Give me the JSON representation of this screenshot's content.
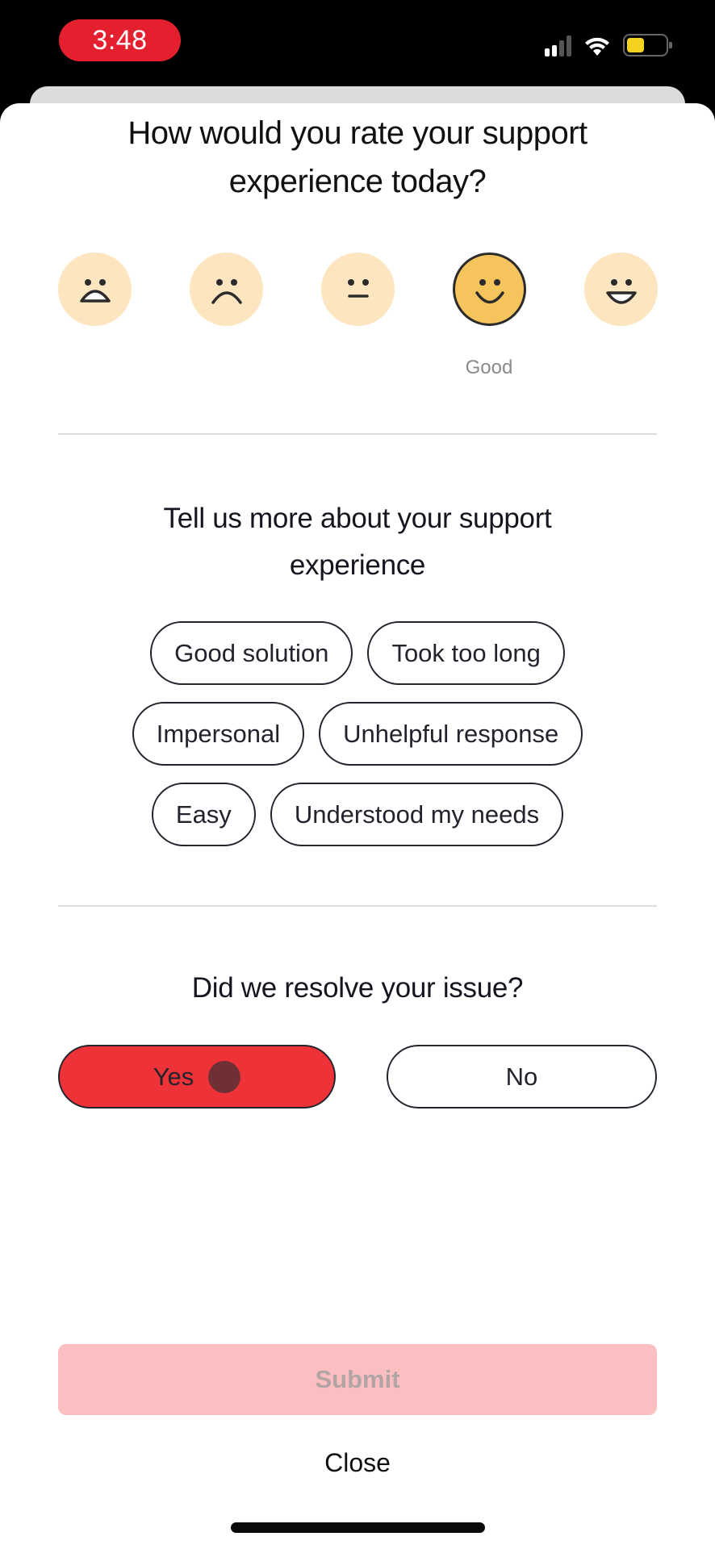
{
  "status_bar": {
    "time": "3:48",
    "icons": [
      "cellular-signal-icon",
      "wifi-icon",
      "battery-icon"
    ],
    "time_pill_color": "#e5202e",
    "battery_color": "#f4d21f"
  },
  "rating": {
    "title_line1": "How would you rate your support",
    "title_line2": "experience today?",
    "options": [
      {
        "icon": "very-sad-face-icon",
        "selected": false
      },
      {
        "icon": "sad-face-icon",
        "selected": false
      },
      {
        "icon": "neutral-face-icon",
        "selected": false
      },
      {
        "icon": "happy-face-icon",
        "selected": true
      },
      {
        "icon": "very-happy-face-icon",
        "selected": false
      }
    ],
    "selected_label": "Good",
    "face_color": "#fde6bf",
    "selected_face_color": "#f6c45c"
  },
  "feedback": {
    "title_line1": "Tell us more about your support",
    "title_line2": "experience",
    "chips": [
      [
        "Good solution",
        "Took too long"
      ],
      [
        "Impersonal",
        "Unhelpful response"
      ],
      [
        "Easy",
        "Understood my needs"
      ]
    ]
  },
  "resolution": {
    "question": "Did we resolve your issue?",
    "yes_label": "Yes",
    "no_label": "No",
    "selected": "Yes",
    "accent_color": "#ee3338"
  },
  "actions": {
    "submit_label": "Submit",
    "submit_enabled": false,
    "close_label": "Close"
  }
}
